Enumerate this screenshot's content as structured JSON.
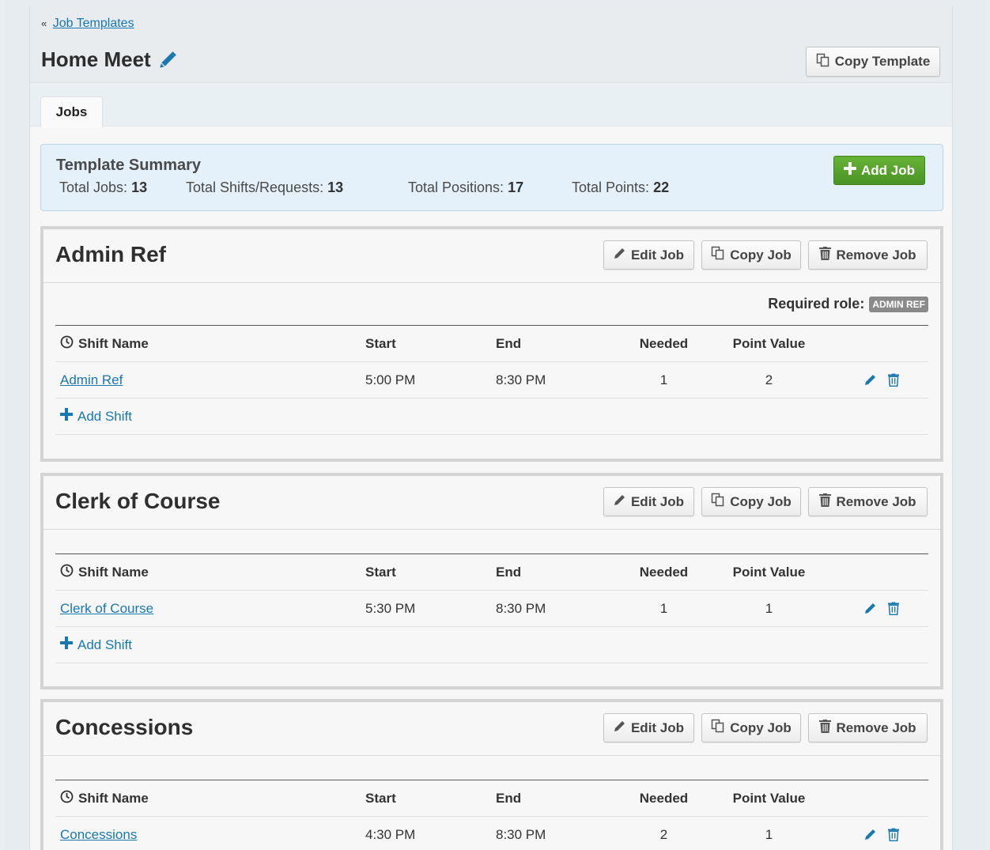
{
  "breadcrumb": {
    "prefix": "«",
    "link": "Job Templates"
  },
  "page_title": "Home Meet",
  "header": {
    "copy_template_label": "Copy Template"
  },
  "tabs": [
    {
      "label": "Jobs"
    }
  ],
  "summary": {
    "title": "Template Summary",
    "total_jobs_label": "Total Jobs:",
    "total_jobs": "13",
    "total_shifts_label": "Total Shifts/Requests:",
    "total_shifts": "13",
    "total_positions_label": "Total Positions:",
    "total_positions": "17",
    "total_points_label": "Total Points:",
    "total_points": "22",
    "add_job_label": "Add Job"
  },
  "buttons": {
    "edit_job": "Edit Job",
    "copy_job": "Copy Job",
    "remove_job": "Remove Job",
    "add_shift": "Add Shift"
  },
  "columns": {
    "shift_name": "Shift Name",
    "start": "Start",
    "end": "End",
    "needed": "Needed",
    "point_value": "Point Value"
  },
  "jobs": [
    {
      "title": "Admin Ref",
      "required_role_label": "Required role:",
      "required_role": "ADMIN REF",
      "shifts": [
        {
          "name": "Admin Ref",
          "start": "5:00 PM",
          "end": "8:30 PM",
          "needed": "1",
          "points": "2"
        }
      ]
    },
    {
      "title": "Clerk of Course",
      "shifts": [
        {
          "name": "Clerk of Course",
          "start": "5:30 PM",
          "end": "8:30 PM",
          "needed": "1",
          "points": "1"
        }
      ]
    },
    {
      "title": "Concessions",
      "shifts": [
        {
          "name": "Concessions",
          "start": "4:30 PM",
          "end": "8:30 PM",
          "needed": "2",
          "points": "1"
        }
      ]
    }
  ],
  "colors": {
    "link": "#1878b0",
    "add_job_green": "#55a02c",
    "summary_bg": "#e4f1fb",
    "badge_gray": "#8a8a8a"
  }
}
